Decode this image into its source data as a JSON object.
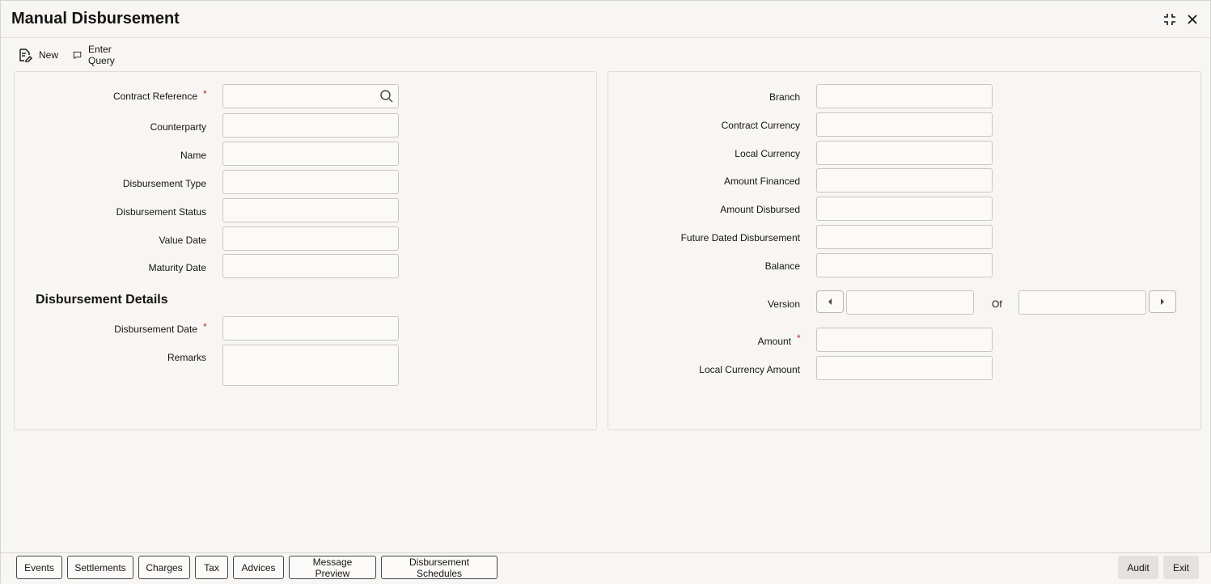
{
  "window": {
    "title": "Manual Disbursement",
    "maximize_icon": "maximize-icon",
    "close_icon": "close-icon"
  },
  "toolbar": {
    "new_label": "New",
    "enter_query_label": "Enter Query"
  },
  "left_panel": {
    "contract_reference": {
      "label": "Contract Reference",
      "required": "*",
      "value": ""
    },
    "counterparty": {
      "label": "Counterparty",
      "value": ""
    },
    "name": {
      "label": "Name",
      "value": ""
    },
    "disbursement_type": {
      "label": "Disbursement Type",
      "value": ""
    },
    "disbursement_status": {
      "label": "Disbursement Status",
      "value": ""
    },
    "value_date": {
      "label": "Value Date",
      "value": ""
    },
    "maturity_date": {
      "label": "Maturity Date",
      "value": ""
    },
    "section_title": "Disbursement Details",
    "disbursement_date": {
      "label": "Disbursement Date",
      "required": "*",
      "value": ""
    },
    "remarks": {
      "label": "Remarks",
      "value": ""
    }
  },
  "right_panel": {
    "branch": {
      "label": "Branch",
      "value": ""
    },
    "contract_currency": {
      "label": "Contract Currency",
      "value": ""
    },
    "local_currency": {
      "label": "Local Currency",
      "value": ""
    },
    "amount_financed": {
      "label": "Amount Financed",
      "value": ""
    },
    "amount_disbursed": {
      "label": "Amount Disbursed",
      "value": ""
    },
    "future_dated_disbursement": {
      "label": "Future Dated Disbursement",
      "value": ""
    },
    "balance": {
      "label": "Balance",
      "value": ""
    },
    "version": {
      "label": "Version",
      "of_label": "Of",
      "current": "",
      "total": ""
    },
    "amount": {
      "label": "Amount",
      "required": "*",
      "value": ""
    },
    "local_currency_amount": {
      "label": "Local Currency Amount",
      "value": ""
    }
  },
  "bottom_tabs": [
    "Events",
    "Settlements",
    "Charges",
    "Tax",
    "Advices",
    "Message Preview",
    "Disbursement Schedules"
  ],
  "bottom_actions": {
    "audit": "Audit",
    "exit": "Exit"
  },
  "colors": {
    "required": "#b0332a",
    "background": "#f7f6f4",
    "border": "#c9c6c2"
  }
}
